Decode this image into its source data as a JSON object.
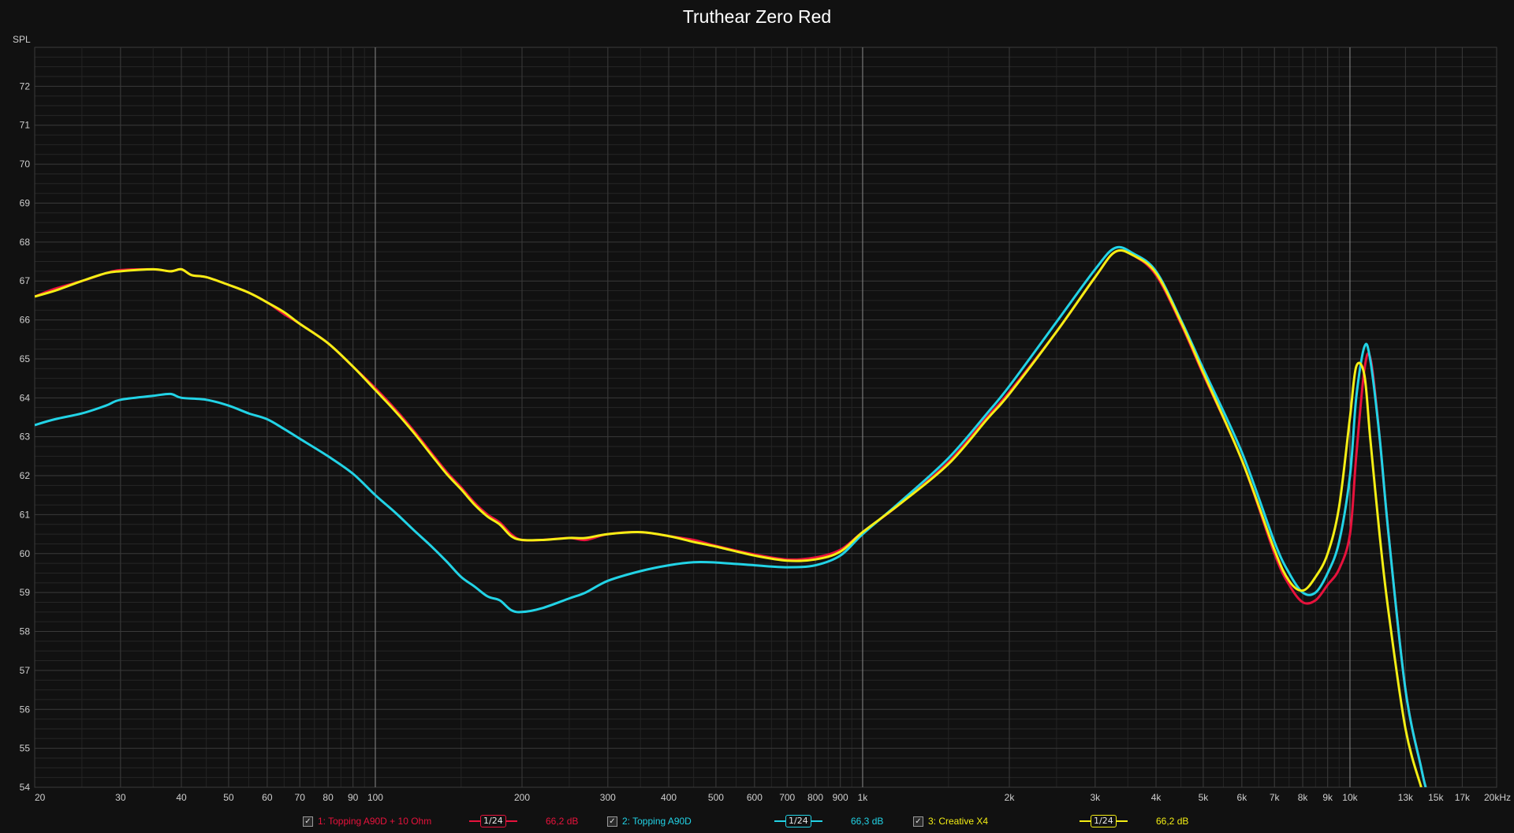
{
  "title": "Truthear Zero Red",
  "colors": {
    "background": "#111111",
    "red": "#e8123c",
    "cyan": "#22d3e6",
    "yellow": "#f4ee14"
  },
  "legend": {
    "items": [
      {
        "check": "✓",
        "label": "1: Topping A90D + 10 Ohm",
        "smoothing": "1/24",
        "level": "66,2 dB",
        "color": "#e8123c"
      },
      {
        "check": "✓",
        "label": "2: Topping A90D",
        "smoothing": "1/24",
        "level": "66,3 dB",
        "color": "#22d3e6"
      },
      {
        "check": "✓",
        "label": "3: Creative X4",
        "smoothing": "1/24",
        "level": "66,2 dB",
        "color": "#f4ee14"
      }
    ]
  },
  "chart_data": {
    "type": "line",
    "title": "Truthear Zero Red",
    "ylabel": "SPL",
    "xlabel": "",
    "xscale": "log",
    "xlim": [
      20,
      20000
    ],
    "ylim": [
      54,
      73
    ],
    "grid": true,
    "legend_position": "bottom",
    "x_ticks": [
      {
        "v": 20,
        "t": "20"
      },
      {
        "v": 30,
        "t": "30"
      },
      {
        "v": 40,
        "t": "40"
      },
      {
        "v": 50,
        "t": "50"
      },
      {
        "v": 60,
        "t": "60"
      },
      {
        "v": 70,
        "t": "70"
      },
      {
        "v": 80,
        "t": "80"
      },
      {
        "v": 90,
        "t": "90"
      },
      {
        "v": 100,
        "t": "100"
      },
      {
        "v": 200,
        "t": "200"
      },
      {
        "v": 300,
        "t": "300"
      },
      {
        "v": 400,
        "t": "400"
      },
      {
        "v": 500,
        "t": "500"
      },
      {
        "v": 600,
        "t": "600"
      },
      {
        "v": 700,
        "t": "700"
      },
      {
        "v": 800,
        "t": "800"
      },
      {
        "v": 900,
        "t": "900"
      },
      {
        "v": 1000,
        "t": "1k"
      },
      {
        "v": 2000,
        "t": "2k"
      },
      {
        "v": 3000,
        "t": "3k"
      },
      {
        "v": 4000,
        "t": "4k"
      },
      {
        "v": 5000,
        "t": "5k"
      },
      {
        "v": 6000,
        "t": "6k"
      },
      {
        "v": 7000,
        "t": "7k"
      },
      {
        "v": 8000,
        "t": "8k"
      },
      {
        "v": 9000,
        "t": "9k"
      },
      {
        "v": 10000,
        "t": "10k"
      },
      {
        "v": 13000,
        "t": "13k"
      },
      {
        "v": 15000,
        "t": "15k"
      },
      {
        "v": 17000,
        "t": "17k"
      },
      {
        "v": 20000,
        "t": "20kHz"
      }
    ],
    "y_ticks": [
      54,
      55,
      56,
      57,
      58,
      59,
      60,
      61,
      62,
      63,
      64,
      65,
      66,
      67,
      68,
      69,
      70,
      71,
      72
    ],
    "series": [
      {
        "name": "1: Topping A90D + 10 Ohm",
        "color": "#e8123c",
        "points": [
          [
            20,
            66.6
          ],
          [
            22,
            66.8
          ],
          [
            25,
            67.0
          ],
          [
            28,
            67.2
          ],
          [
            30,
            67.28
          ],
          [
            35,
            67.3
          ],
          [
            38,
            67.25
          ],
          [
            40,
            67.3
          ],
          [
            42,
            67.15
          ],
          [
            45,
            67.1
          ],
          [
            50,
            66.9
          ],
          [
            55,
            66.7
          ],
          [
            60,
            66.45
          ],
          [
            65,
            66.15
          ],
          [
            70,
            65.9
          ],
          [
            80,
            65.4
          ],
          [
            90,
            64.8
          ],
          [
            100,
            64.25
          ],
          [
            110,
            63.7
          ],
          [
            120,
            63.15
          ],
          [
            130,
            62.6
          ],
          [
            140,
            62.1
          ],
          [
            150,
            61.7
          ],
          [
            160,
            61.3
          ],
          [
            170,
            61.0
          ],
          [
            180,
            60.8
          ],
          [
            190,
            60.5
          ],
          [
            200,
            60.35
          ],
          [
            220,
            60.35
          ],
          [
            250,
            60.4
          ],
          [
            270,
            60.35
          ],
          [
            300,
            60.5
          ],
          [
            350,
            60.55
          ],
          [
            400,
            60.45
          ],
          [
            450,
            60.35
          ],
          [
            500,
            60.2
          ],
          [
            600,
            59.98
          ],
          [
            700,
            59.85
          ],
          [
            800,
            59.9
          ],
          [
            900,
            60.1
          ],
          [
            1000,
            60.55
          ],
          [
            1200,
            61.3
          ],
          [
            1500,
            62.35
          ],
          [
            1800,
            63.5
          ],
          [
            2000,
            64.15
          ],
          [
            2500,
            65.7
          ],
          [
            3000,
            67.1
          ],
          [
            3300,
            67.75
          ],
          [
            3600,
            67.65
          ],
          [
            4000,
            67.15
          ],
          [
            4500,
            65.9
          ],
          [
            5000,
            64.6
          ],
          [
            6000,
            62.4
          ],
          [
            7000,
            60.0
          ],
          [
            7500,
            59.2
          ],
          [
            8000,
            58.75
          ],
          [
            8500,
            58.8
          ],
          [
            9000,
            59.2
          ],
          [
            9500,
            59.6
          ],
          [
            10000,
            60.5
          ],
          [
            10300,
            62.5
          ],
          [
            10700,
            64.7
          ],
          [
            11000,
            65.05
          ],
          [
            11400,
            63.5
          ],
          [
            12000,
            60.5
          ],
          [
            13000,
            56.5
          ],
          [
            14000,
            54.5
          ],
          [
            14300,
            54.0
          ]
        ]
      },
      {
        "name": "2: Topping A90D",
        "color": "#22d3e6",
        "points": [
          [
            20,
            63.3
          ],
          [
            22,
            63.45
          ],
          [
            25,
            63.6
          ],
          [
            28,
            63.8
          ],
          [
            30,
            63.95
          ],
          [
            35,
            64.05
          ],
          [
            38,
            64.1
          ],
          [
            40,
            64.0
          ],
          [
            45,
            63.95
          ],
          [
            50,
            63.8
          ],
          [
            55,
            63.6
          ],
          [
            60,
            63.45
          ],
          [
            65,
            63.2
          ],
          [
            70,
            62.95
          ],
          [
            80,
            62.5
          ],
          [
            90,
            62.05
          ],
          [
            100,
            61.5
          ],
          [
            110,
            61.05
          ],
          [
            120,
            60.6
          ],
          [
            130,
            60.2
          ],
          [
            140,
            59.8
          ],
          [
            150,
            59.4
          ],
          [
            160,
            59.15
          ],
          [
            170,
            58.9
          ],
          [
            180,
            58.8
          ],
          [
            190,
            58.55
          ],
          [
            200,
            58.5
          ],
          [
            220,
            58.6
          ],
          [
            250,
            58.85
          ],
          [
            270,
            59.0
          ],
          [
            300,
            59.3
          ],
          [
            350,
            59.55
          ],
          [
            400,
            59.7
          ],
          [
            450,
            59.78
          ],
          [
            500,
            59.77
          ],
          [
            600,
            59.7
          ],
          [
            700,
            59.65
          ],
          [
            800,
            59.7
          ],
          [
            900,
            59.95
          ],
          [
            1000,
            60.5
          ],
          [
            1200,
            61.35
          ],
          [
            1500,
            62.45
          ],
          [
            1800,
            63.6
          ],
          [
            2000,
            64.3
          ],
          [
            2500,
            65.95
          ],
          [
            3000,
            67.3
          ],
          [
            3300,
            67.85
          ],
          [
            3600,
            67.7
          ],
          [
            4000,
            67.25
          ],
          [
            4500,
            66.0
          ],
          [
            5000,
            64.75
          ],
          [
            6000,
            62.6
          ],
          [
            7000,
            60.3
          ],
          [
            7500,
            59.5
          ],
          [
            8000,
            59.0
          ],
          [
            8500,
            59.0
          ],
          [
            9000,
            59.5
          ],
          [
            9500,
            60.3
          ],
          [
            10000,
            62.0
          ],
          [
            10300,
            64.0
          ],
          [
            10700,
            65.3
          ],
          [
            11000,
            65.0
          ],
          [
            11500,
            63.0
          ],
          [
            12000,
            60.5
          ],
          [
            13000,
            56.5
          ],
          [
            14000,
            54.5
          ],
          [
            14300,
            54.0
          ]
        ]
      },
      {
        "name": "3: Creative X4",
        "color": "#f4ee14",
        "points": [
          [
            20,
            66.6
          ],
          [
            22,
            66.75
          ],
          [
            25,
            67.0
          ],
          [
            28,
            67.2
          ],
          [
            30,
            67.25
          ],
          [
            35,
            67.3
          ],
          [
            38,
            67.25
          ],
          [
            40,
            67.3
          ],
          [
            42,
            67.15
          ],
          [
            45,
            67.1
          ],
          [
            50,
            66.9
          ],
          [
            55,
            66.7
          ],
          [
            60,
            66.45
          ],
          [
            65,
            66.2
          ],
          [
            70,
            65.9
          ],
          [
            80,
            65.4
          ],
          [
            90,
            64.8
          ],
          [
            100,
            64.2
          ],
          [
            110,
            63.65
          ],
          [
            120,
            63.1
          ],
          [
            130,
            62.55
          ],
          [
            140,
            62.05
          ],
          [
            150,
            61.65
          ],
          [
            160,
            61.25
          ],
          [
            170,
            60.95
          ],
          [
            180,
            60.75
          ],
          [
            190,
            60.45
          ],
          [
            200,
            60.35
          ],
          [
            220,
            60.35
          ],
          [
            250,
            60.4
          ],
          [
            270,
            60.4
          ],
          [
            300,
            60.5
          ],
          [
            350,
            60.55
          ],
          [
            400,
            60.45
          ],
          [
            450,
            60.3
          ],
          [
            500,
            60.18
          ],
          [
            600,
            59.95
          ],
          [
            700,
            59.82
          ],
          [
            800,
            59.85
          ],
          [
            900,
            60.05
          ],
          [
            1000,
            60.55
          ],
          [
            1200,
            61.3
          ],
          [
            1500,
            62.3
          ],
          [
            1800,
            63.45
          ],
          [
            2000,
            64.1
          ],
          [
            2500,
            65.7
          ],
          [
            3000,
            67.1
          ],
          [
            3300,
            67.75
          ],
          [
            3600,
            67.65
          ],
          [
            4000,
            67.2
          ],
          [
            4500,
            65.95
          ],
          [
            5000,
            64.65
          ],
          [
            6000,
            62.4
          ],
          [
            7000,
            60.1
          ],
          [
            7500,
            59.3
          ],
          [
            8000,
            59.05
          ],
          [
            8500,
            59.4
          ],
          [
            9000,
            60.0
          ],
          [
            9500,
            61.2
          ],
          [
            10000,
            63.5
          ],
          [
            10300,
            64.8
          ],
          [
            10700,
            64.6
          ],
          [
            11000,
            63.0
          ],
          [
            11500,
            60.5
          ],
          [
            12000,
            58.5
          ],
          [
            13000,
            55.5
          ],
          [
            14000,
            54.0
          ]
        ]
      }
    ]
  }
}
